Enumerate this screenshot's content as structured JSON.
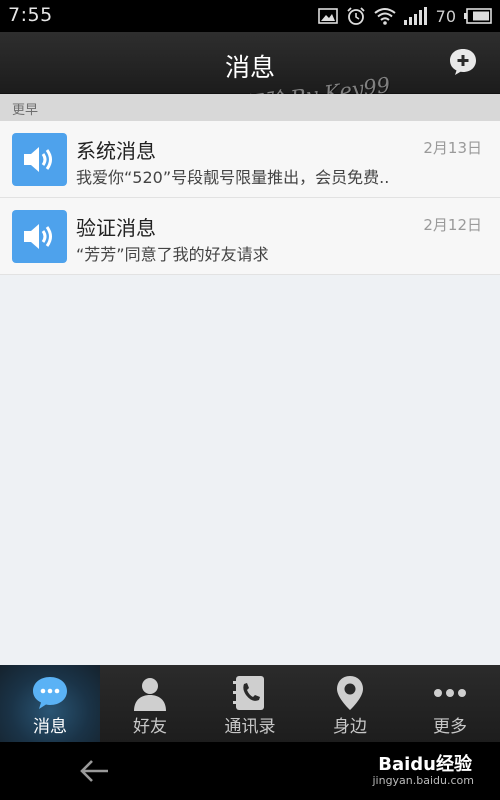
{
  "status_bar": {
    "time": "7:55",
    "battery": "70",
    "icons": [
      "image-icon",
      "alarm-icon",
      "wifi-icon",
      "signal-icon",
      "battery-icon"
    ]
  },
  "header": {
    "title": "消息",
    "watermark": "百度经验 By Key99",
    "add_icon": "add-chat-icon"
  },
  "section": {
    "label": "更早"
  },
  "messages": [
    {
      "title": "系统消息",
      "date": "2月13日",
      "preview": "我爱你“520”号段靓号限量推出，会员免费..",
      "icon": "speaker-icon"
    },
    {
      "title": "验证消息",
      "date": "2月12日",
      "preview": "“芳芳”同意了我的好友请求",
      "icon": "speaker-icon"
    }
  ],
  "tabs": [
    {
      "label": "消息",
      "icon": "chat-bubble-icon",
      "active": true
    },
    {
      "label": "好友",
      "icon": "person-icon",
      "active": false
    },
    {
      "label": "通讯录",
      "icon": "contacts-icon",
      "active": false
    },
    {
      "label": "身边",
      "icon": "location-pin-icon",
      "active": false
    },
    {
      "label": "更多",
      "icon": "more-dots-icon",
      "active": false
    }
  ],
  "nav": {
    "back_icon": "back-arrow-icon",
    "logo_text": "Baidu经验",
    "logo_url": "jingyan.baidu.com"
  },
  "colors": {
    "accent": "#4ea2ec",
    "tab_active": "#1a3347"
  }
}
